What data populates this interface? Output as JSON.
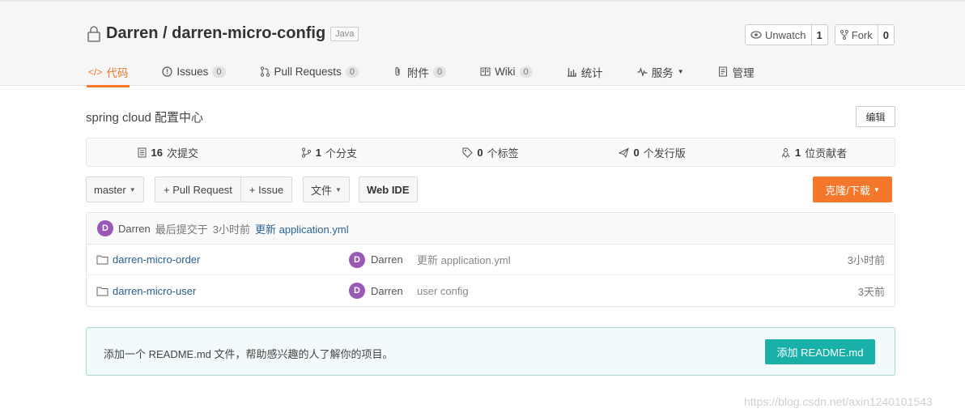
{
  "repo": {
    "title": "Darren / darren-micro-config",
    "language": "Java",
    "watch_label": "Unwatch",
    "watch_count": "1",
    "fork_label": "Fork",
    "fork_count": "0"
  },
  "tabs": [
    {
      "label": "代码",
      "icon": "code-icon",
      "active": true
    },
    {
      "label": "Issues",
      "icon": "issue-icon",
      "badge": "0"
    },
    {
      "label": "Pull Requests",
      "icon": "pull-request-icon",
      "badge": "0"
    },
    {
      "label": "附件",
      "icon": "paperclip-icon",
      "badge": "0"
    },
    {
      "label": "Wiki",
      "icon": "book-icon",
      "badge": "0"
    },
    {
      "label": "统计",
      "icon": "bar-chart-icon"
    },
    {
      "label": "服务",
      "icon": "pulse-icon",
      "dropdown": true
    },
    {
      "label": "管理",
      "icon": "settings-doc-icon"
    }
  ],
  "description": "spring cloud 配置中心",
  "edit_label": "编辑",
  "stats": [
    {
      "count": "16",
      "label": "次提交",
      "icon": "commit-icon"
    },
    {
      "count": "1",
      "label": "个分支",
      "icon": "branch-icon"
    },
    {
      "count": "0",
      "label": "个标签",
      "icon": "tag-icon"
    },
    {
      "count": "0",
      "label": "个发行版",
      "icon": "release-icon"
    },
    {
      "count": "1",
      "label": "位贡献者",
      "icon": "contributors-icon"
    }
  ],
  "toolbar": {
    "branch": "master",
    "pull_request": "+ Pull Request",
    "issue": "+ Issue",
    "file": "文件",
    "web_ide": "Web IDE",
    "clone": "克隆/下载"
  },
  "last_commit": {
    "avatar": "D",
    "author": "Darren",
    "prefix": "最后提交于",
    "time": "3小时前",
    "message": "更新 application.yml"
  },
  "files": [
    {
      "name": "darren-micro-order",
      "avatar": "D",
      "author": "Darren",
      "message": "更新 application.yml",
      "time": "3小时前"
    },
    {
      "name": "darren-micro-user",
      "avatar": "D",
      "author": "Darren",
      "message": "user config",
      "time": "3天前"
    }
  ],
  "readme": {
    "text": "添加一个 README.md 文件，帮助感兴趣的人了解你的项目。",
    "button": "添加 README.md"
  },
  "watermark": "https://blog.csdn.net/axin1240101543",
  "colors": {
    "accent": "#f4772b",
    "teal": "#18b0a8",
    "avatar": "#9b59b6"
  }
}
